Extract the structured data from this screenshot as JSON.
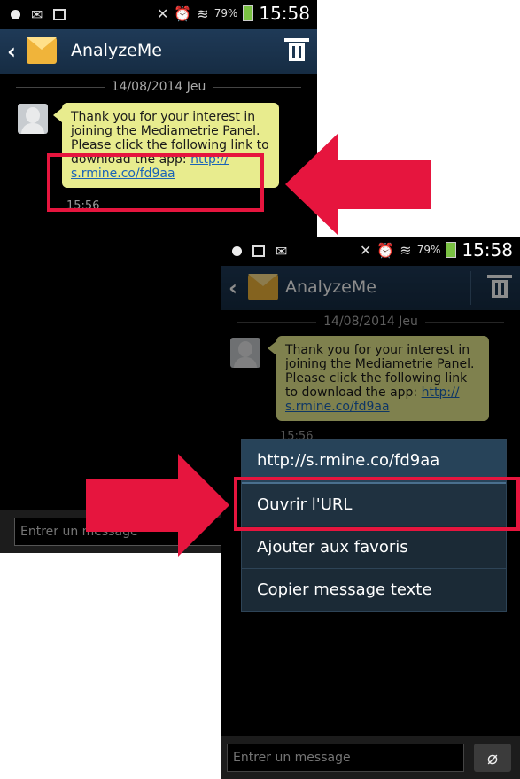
{
  "status_bar": {
    "battery": "79%",
    "time": "15:58"
  },
  "conversation": {
    "title": "AnalyzeMe",
    "date": "14/08/2014 Jeu",
    "message": {
      "text": "Thank you for your interest in joining the Mediametrie Panel. Please click the following link to download the app: ",
      "link": "http://s.rmine.co/fd9aa",
      "link_display": "http://\ns.rmine.co/fd9aa",
      "time": "15:56"
    },
    "composer_placeholder": "Entrer un message"
  },
  "context_menu": {
    "title": "http://s.rmine.co/fd9aa",
    "items": [
      {
        "label": "Ouvrir l'URL",
        "selected": true
      },
      {
        "label": "Ajouter aux favoris"
      },
      {
        "label": "Copier message texte"
      }
    ]
  },
  "colors": {
    "highlight": "#e6153e",
    "actionbar": "#1f3a57",
    "bubble": "#e8ec8e"
  }
}
